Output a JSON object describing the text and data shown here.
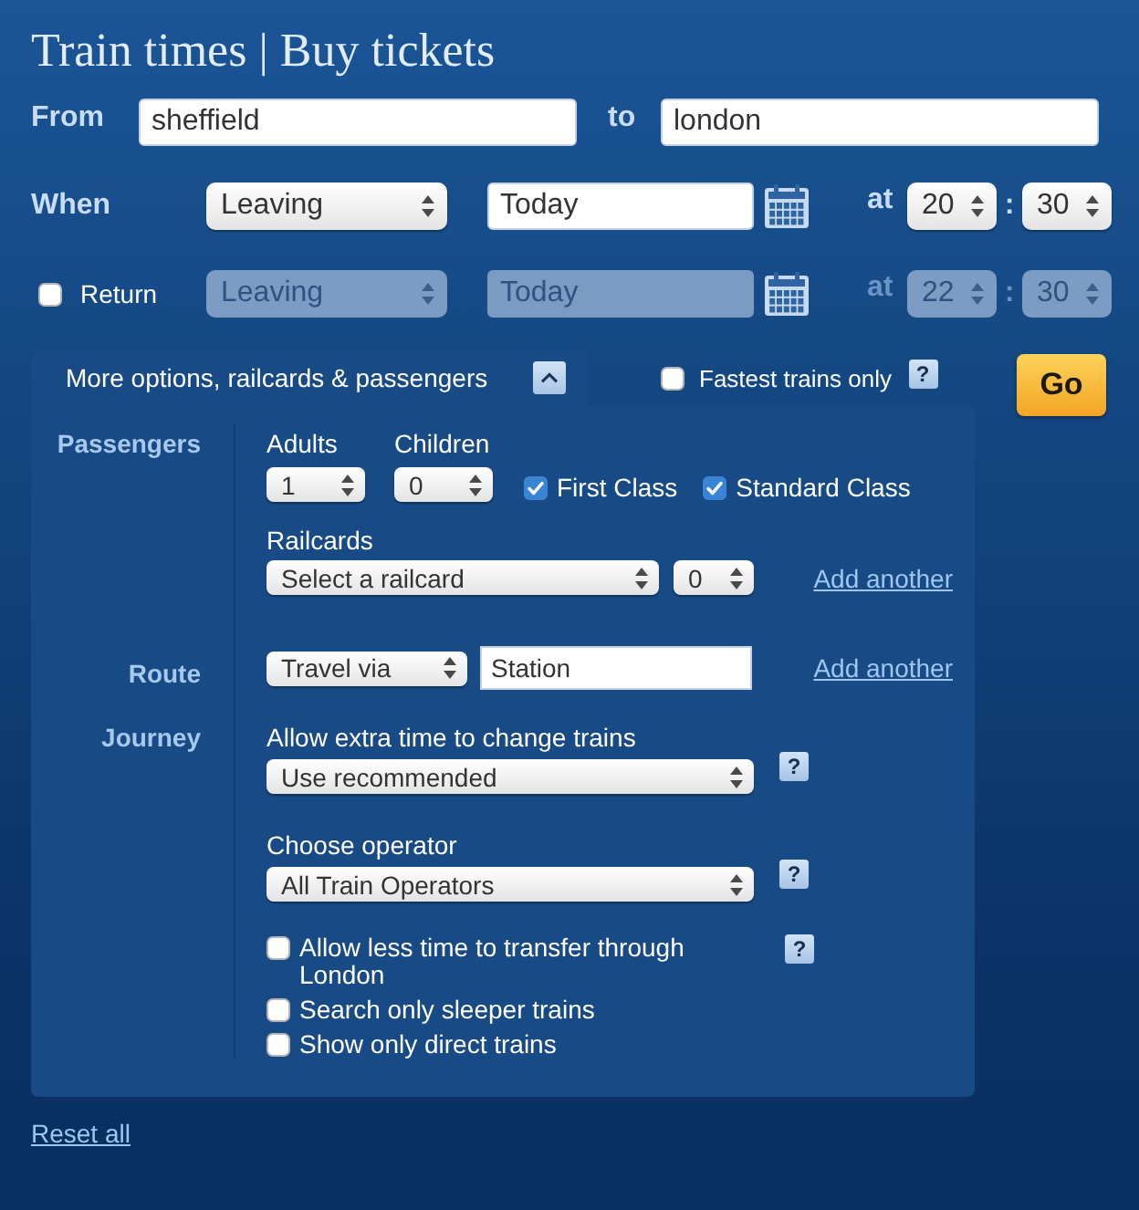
{
  "heading": "Train times | Buy tickets",
  "from": {
    "label": "From",
    "value": "sheffield"
  },
  "to": {
    "label": "to",
    "value": "london"
  },
  "outbound": {
    "label": "When",
    "disabled": false,
    "mode": "Leaving",
    "date": "Today",
    "at_label": "at",
    "hour": "20",
    "separator": ":",
    "minute": "30"
  },
  "return": {
    "label": "Return",
    "checked": false,
    "disabled": true,
    "mode": "Leaving",
    "date": "Today",
    "at_label": "at",
    "hour": "22",
    "separator": ":",
    "minute": "30"
  },
  "options_tab": {
    "label": "More options, railcards & passengers",
    "expanded": true
  },
  "fastest": {
    "label": "Fastest trains only",
    "checked": false,
    "help": "?"
  },
  "go_button": "Go",
  "passengers": {
    "label": "Passengers",
    "adults": {
      "label": "Adults",
      "value": "1"
    },
    "children": {
      "label": "Children",
      "value": "0"
    },
    "classes": [
      {
        "label": "First Class",
        "checked": true
      },
      {
        "label": "Standard Class",
        "checked": true
      }
    ],
    "railcards": {
      "label": "Railcards",
      "value": "Select a railcard",
      "count": "0",
      "link": "Add another"
    }
  },
  "route": {
    "label": "Route",
    "via": "Travel via",
    "station": "Station",
    "link": "Add another"
  },
  "journey": {
    "label": "Journey",
    "extra_time": {
      "label": "Allow extra time to change trains",
      "value": "Use recommended",
      "help": "?"
    },
    "operator": {
      "label": "Choose operator",
      "value": "All Train Operators",
      "help": "?"
    },
    "options": [
      {
        "label": "Allow less time to transfer through London",
        "checked": false,
        "help": "?"
      },
      {
        "label": "Search only sleeper trains",
        "checked": false
      },
      {
        "label": "Show only direct trains",
        "checked": false
      }
    ]
  },
  "reset_link": "Reset all"
}
